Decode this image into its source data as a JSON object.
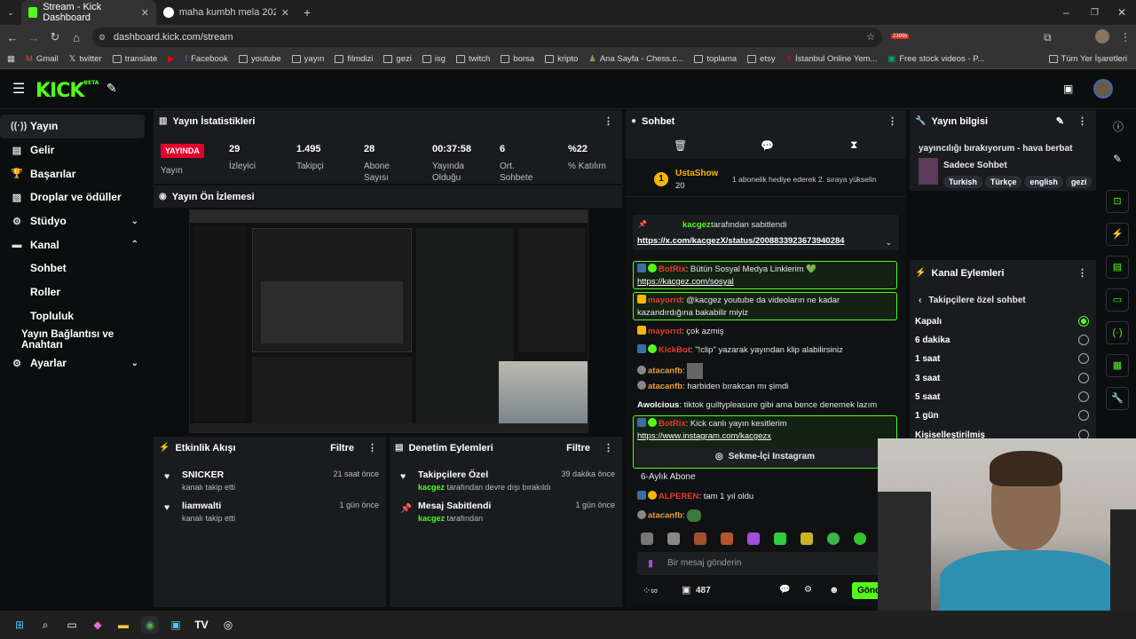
{
  "browser": {
    "tabs": [
      {
        "title": "Stream - Kick Dashboard",
        "active": true
      },
      {
        "title": "maha kumbh mela 2025 - Goo",
        "active": false
      }
    ],
    "url": "dashboard.kick.com/stream",
    "bookmarks": [
      "Gmail",
      "twitter",
      "translate",
      "Facebook",
      "youtube",
      "yayın",
      "filmdizi",
      "gezi",
      "isg",
      "twitch",
      "borsa",
      "kripto",
      "Ana Sayfa - Chess.c...",
      "toplama",
      "etsy",
      "İstanbul Online Yem...",
      "Free stock videos - P..."
    ],
    "all_bookmarks": "Tüm Yer İşaretleri",
    "ext_badge": "2399k"
  },
  "brand": {
    "logo": "KICK",
    "beta": "BETA",
    "accent": "#53fc18"
  },
  "sidebar": {
    "items": [
      {
        "label": "Yayın"
      },
      {
        "label": "Gelir"
      },
      {
        "label": "Başarılar"
      },
      {
        "label": "Droplar ve ödüller"
      },
      {
        "label": "Stüdyo"
      },
      {
        "label": "Kanal"
      },
      {
        "label": "Sohbet"
      },
      {
        "label": "Roller"
      },
      {
        "label": "Topluluk"
      },
      {
        "label": "Yayın Bağlantısı ve Anahtarı"
      },
      {
        "label": "Ayarlar"
      }
    ]
  },
  "stats": {
    "title": "Yayın İstatistikleri",
    "live": "YAYINDA",
    "live_label": "Yayın",
    "items": [
      {
        "value": "29",
        "label": "İzleyici"
      },
      {
        "value": "1.495",
        "label": "Takipçi"
      },
      {
        "value": "28",
        "label": "Abone Sayısı"
      },
      {
        "value": "00:37:58",
        "label": "Yayında Olduğu"
      },
      {
        "value": "6",
        "label": "Ort. Sohbete"
      },
      {
        "value": "%22",
        "label": "% Katılım"
      }
    ]
  },
  "preview": {
    "title": "Yayın Ön İzlemesi"
  },
  "activity": {
    "title": "Etkinlik Akışı",
    "filter": "Filtre",
    "items": [
      {
        "name": "SNICKER",
        "desc": "kanalı takip etti",
        "time": "21 saat önce"
      },
      {
        "name": "liamwalti",
        "desc": "kanalı takip etti",
        "time": "1 gün önce"
      }
    ]
  },
  "moderation": {
    "title": "Denetim Eylemleri",
    "filter": "Filtre",
    "items": [
      {
        "name": "Takipçilere Özel",
        "user": "kacgez",
        "desc": "tarafından devre dışı bırakıldı",
        "time": "39 dakika önce"
      },
      {
        "name": "Mesaj Sabitlendi",
        "user": "kacgez",
        "desc": "tarafından",
        "time": "1 gün önce"
      }
    ]
  },
  "chat": {
    "title": "Sohbet",
    "top_gifter": {
      "name": "UstaShow",
      "count": "20",
      "hint": "1 abonelik hediye ederek 2. sıraya yükselin"
    },
    "pinned": {
      "user": "kacgez",
      "by": "tarafından sabitlendi",
      "link": "https://x.com/kacgezX/status/2008833923673940284"
    },
    "messages": [
      {
        "user": "BotRix",
        "text": "Bütün Sosyal Medya Linklerim 💚",
        "link": "https://kacgez.com/sosyal",
        "color": "#e8392f"
      },
      {
        "user": "mayorrd",
        "text": "@kacgez youtube da videoların ne kadar kazandırdığına bakabilir miyiz",
        "color": "#e8392f"
      },
      {
        "user": "mayorrd",
        "text": "çok azmiş",
        "color": "#e8392f"
      },
      {
        "user": "KickBot",
        "text": "\"!clip\" yazarak yayından klip alabilirsiniz",
        "color": "#e8392f"
      },
      {
        "user": "atacanfb",
        "text": "",
        "color": "#e8a03c"
      },
      {
        "user": "atacanfb",
        "text": "harbiden bırakcan mı şimdi",
        "color": "#e8a03c"
      },
      {
        "user": "Awolcious",
        "text": "tiktok guiltypleasure gibi ama bence denemek lazım",
        "color": "#ffffff"
      },
      {
        "user": "BotRix",
        "text": "Kick canlı yayın kesitlerim",
        "link": "https://www.instagram.com/kacgezx",
        "color": "#e8392f"
      },
      {
        "user": "ALPEREN",
        "text": "tam 1 yıl oldu",
        "color": "#e8392f"
      },
      {
        "user": "atacanfb",
        "text": "",
        "color": "#e8a03c"
      }
    ],
    "instagram_button": "Sekme-İçi Instagram",
    "sub_notice": "6-Aylık Abone",
    "input_placeholder": "Bir mesaj gönderin",
    "points": "487",
    "send": "Gönder"
  },
  "stream_info": {
    "title": "Yayın bilgisi",
    "stream_title": "yayıncılığı bırakıyorum - hava berbat",
    "category": "Sadece Sohbet",
    "tags": [
      "Turkish",
      "Türkçe",
      "english",
      "gezi"
    ]
  },
  "channel_actions": {
    "title": "Kanal Eylemleri",
    "back_label": "Takipçilere özel sohbet",
    "options": [
      {
        "label": "Kapalı",
        "selected": true
      },
      {
        "label": "6 dakika",
        "selected": false
      },
      {
        "label": "1 saat",
        "selected": false
      },
      {
        "label": "3 saat",
        "selected": false
      },
      {
        "label": "5 saat",
        "selected": false
      },
      {
        "label": "1 gün",
        "selected": false
      },
      {
        "label": "Kişiselleştirilmiş",
        "selected": false
      }
    ]
  }
}
